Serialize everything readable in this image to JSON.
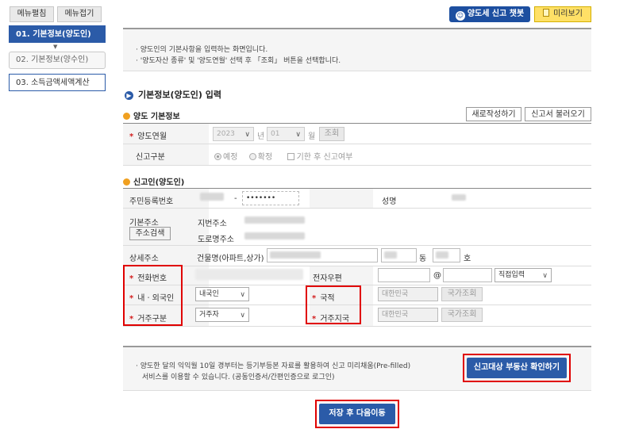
{
  "sidebar": {
    "expand_label": "메뉴펼침",
    "collapse_label": "메뉴접기",
    "arrow": "▼",
    "items": [
      {
        "label": "01. 기본정보(양도인)"
      },
      {
        "label": "02. 기본정보(양수인)"
      },
      {
        "label": "03. 소득금액세액계산"
      }
    ]
  },
  "topbar": {
    "chatbot_label": "양도세 신고 챗봇",
    "preview_label": "미리보기"
  },
  "intro": {
    "line1": "· 양도인의 기본사항을 입력하는 화면입니다.",
    "line2": "· '양도자산 종류' 및 '양도연월' 선택 후 「조회」 버튼을 선택합니다."
  },
  "page_title": "기본정보(양도인) 입력",
  "basic": {
    "section_title": "양도 기본정보",
    "new_button": "새로작성하기",
    "load_button": "신고서 불러오기",
    "period_label": "양도연월",
    "year": "2023",
    "year_suffix": "년",
    "month": "01",
    "month_suffix": "월",
    "search_button": "조회",
    "type_label": "신고구분",
    "opt_scheduled": "예정",
    "opt_final": "확정",
    "opt_late": "기한 후 신고여부"
  },
  "reporter": {
    "section_title": "신고인(양도인)",
    "rrn_label": "주민등록번호",
    "rrn_dash": "-",
    "rrn_masked": "•••••••",
    "name_label": "성명",
    "addr_label": "기본주소",
    "addr_search": "주소검색",
    "jibun_label": "지번주소",
    "road_label": "도로명주소",
    "detail_label": "상세주소",
    "building_label": "건물명(아파트,상가)",
    "dong": "동",
    "ho": "호",
    "phone_label": "전화번호",
    "email_label": "전자우편",
    "at": "@",
    "email_domain": "직접입력",
    "nat_type_label": "내ㆍ외국인",
    "nat_type_value": "내국인",
    "nationality_label": "국적",
    "nationality_value": "대한민국",
    "country_search": "국가조회",
    "residence_label": "거주구분",
    "residence_value": "거주자",
    "res_country_label": "거주지국",
    "res_country_value": "대한민국",
    "country_search2": "국가조회"
  },
  "notice": {
    "line1": "· 양도한 달의 익익월 10일 경부터는 등기부등본 자료를 활용하여 신고 미리채움(Pre-filled)",
    "line2": "서비스를 이용할 수 있습니다. (공동인증서/간편인증으로 로그인)",
    "check_button": "신고대상 부동산 확인하기"
  },
  "save_button": "저장 후 다음이동",
  "colors": {
    "accent": "#2b5ba8",
    "highlight": "#e00000",
    "required": "#d21e1e"
  }
}
